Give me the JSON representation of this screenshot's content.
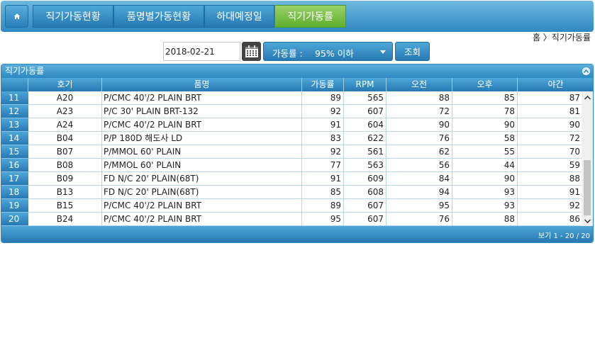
{
  "nav": {
    "home_icon": "home-icon",
    "tabs": [
      {
        "label": "직기가동현황",
        "active": false
      },
      {
        "label": "품명별가동현황",
        "active": false
      },
      {
        "label": "하대예정일",
        "active": false
      },
      {
        "label": "직기가동률",
        "active": true
      }
    ]
  },
  "breadcrumb": "홈 〉직기가동률",
  "search": {
    "date_value": "2018-02-21",
    "calendar_icon": "calendar-icon",
    "filter_label": "가동률 :",
    "filter_value": "95% 이하",
    "search_button": "조회"
  },
  "grid": {
    "title": "직기가동률",
    "columns": [
      "",
      "호기",
      "품명",
      "가동률",
      "RPM",
      "오전",
      "오후",
      "야간"
    ],
    "rows": [
      {
        "no": "11",
        "machine": "A20",
        "product": "P/CMC 40'/2  PLAIN BRT",
        "rate": "89",
        "rpm": "565",
        "am": "88",
        "pm": "85",
        "night": "87"
      },
      {
        "no": "12",
        "machine": "A23",
        "product": "P/C 30' PLAIN BRT-132",
        "rate": "92",
        "rpm": "607",
        "am": "72",
        "pm": "78",
        "night": "81"
      },
      {
        "no": "13",
        "machine": "A24",
        "product": "P/CMC 40'/2  PLAIN BRT",
        "rate": "91",
        "rpm": "604",
        "am": "90",
        "pm": "90",
        "night": "90"
      },
      {
        "no": "14",
        "machine": "B04",
        "product": "P/P 180D 해도사 LD",
        "rate": "83",
        "rpm": "622",
        "am": "76",
        "pm": "58",
        "night": "72"
      },
      {
        "no": "15",
        "machine": "B07",
        "product": "P/MMOL 60' PLAIN",
        "rate": "92",
        "rpm": "561",
        "am": "62",
        "pm": "55",
        "night": "70"
      },
      {
        "no": "16",
        "machine": "B08",
        "product": "P/MMOL 60' PLAIN",
        "rate": "77",
        "rpm": "563",
        "am": "56",
        "pm": "44",
        "night": "59"
      },
      {
        "no": "17",
        "machine": "B09",
        "product": "FD N/C 20' PLAIN(68T)",
        "rate": "91",
        "rpm": "609",
        "am": "84",
        "pm": "90",
        "night": "88"
      },
      {
        "no": "18",
        "machine": "B13",
        "product": "FD N/C 20' PLAIN(68T)",
        "rate": "85",
        "rpm": "608",
        "am": "94",
        "pm": "93",
        "night": "91"
      },
      {
        "no": "19",
        "machine": "B15",
        "product": "P/CMC 40'/2  PLAIN BRT",
        "rate": "89",
        "rpm": "607",
        "am": "95",
        "pm": "93",
        "night": "92"
      },
      {
        "no": "20",
        "machine": "B24",
        "product": "P/CMC 40'/2  PLAIN BRT",
        "rate": "95",
        "rpm": "607",
        "am": "76",
        "pm": "88",
        "night": "86"
      }
    ],
    "pager": "보기 1 - 20 / 20"
  },
  "colors": {
    "nav_blue": "#2e89c2",
    "active_tab_green": "#5fae2f",
    "grid_border": "#b7d7ea"
  }
}
